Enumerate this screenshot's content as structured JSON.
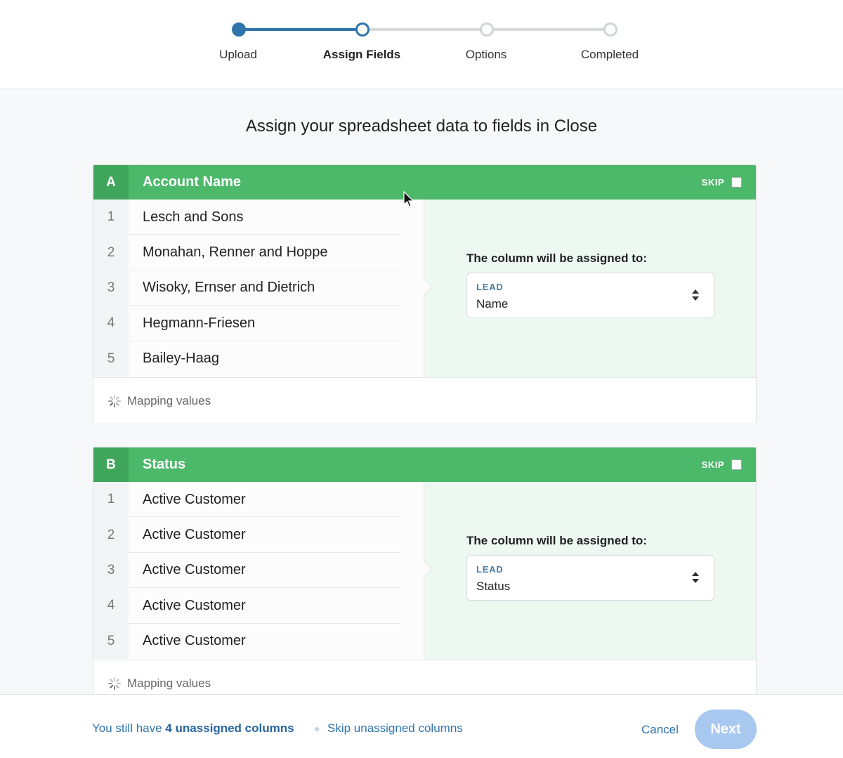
{
  "stepper": {
    "steps": [
      {
        "label": "Upload",
        "state": "done"
      },
      {
        "label": "Assign Fields",
        "state": "current"
      },
      {
        "label": "Options",
        "state": "todo"
      },
      {
        "label": "Completed",
        "state": "todo"
      }
    ]
  },
  "heading": "Assign your spreadsheet data to fields in Close",
  "colors": {
    "accent_blue": "#2f74ac",
    "header_green": "#4cb86a",
    "panel_green": "#ecf8f0",
    "next_disabled": "#a9c8ef"
  },
  "columns": [
    {
      "letter": "A",
      "title": "Account Name",
      "skip_label": "SKIP",
      "skip_checked": false,
      "rows": [
        {
          "num": "1",
          "value": "Lesch and Sons"
        },
        {
          "num": "2",
          "value": "Monahan, Renner and Hoppe"
        },
        {
          "num": "3",
          "value": "Wisoky, Ernser and Dietrich"
        },
        {
          "num": "4",
          "value": "Hegmann-Friesen"
        },
        {
          "num": "5",
          "value": "Bailey-Haag"
        }
      ],
      "assign_label": "The column will be assigned to:",
      "assign_category": "LEAD",
      "assign_field": "Name",
      "footer_status": "Mapping values"
    },
    {
      "letter": "B",
      "title": "Status",
      "skip_label": "SKIP",
      "skip_checked": false,
      "rows": [
        {
          "num": "1",
          "value": "Active Customer"
        },
        {
          "num": "2",
          "value": "Active Customer"
        },
        {
          "num": "3",
          "value": "Active Customer"
        },
        {
          "num": "4",
          "value": "Active Customer"
        },
        {
          "num": "5",
          "value": "Active Customer"
        }
      ],
      "assign_label": "The column will be assigned to:",
      "assign_category": "LEAD",
      "assign_field": "Status",
      "footer_status": "Mapping values"
    }
  ],
  "bottom": {
    "unassigned_prefix": "You still have ",
    "unassigned_count_text": "4 unassigned columns",
    "skip_link": "Skip unassigned columns",
    "cancel": "Cancel",
    "next": "Next"
  }
}
